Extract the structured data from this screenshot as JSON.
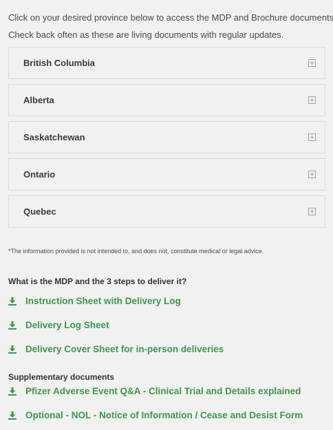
{
  "intro": {
    "line1": "Click on your desired province below to access the MDP and Brochure documents.",
    "line2": "Check back often as these are living documents with regular updates."
  },
  "provinces": [
    {
      "label": "British Columbia",
      "icon": "plus-square-icon"
    },
    {
      "label": "Alberta",
      "icon": "plus-square-icon"
    },
    {
      "label": "Saskatchewan",
      "icon": "plus-square-icon"
    },
    {
      "label": "Ontario",
      "icon": "plus-square-icon"
    },
    {
      "label": "Quebec",
      "icon": "plus-square-icon"
    }
  ],
  "disclaimer": "*The information provided is not intended to, and does not, constitute medical or legal advice.",
  "mdp_section": {
    "heading": "What is the MDP and the 3 steps to deliver it?",
    "links": [
      {
        "label": "Instruction Sheet with Delivery Log",
        "icon": "download-icon"
      },
      {
        "label": "Delivery Log Sheet",
        "icon": "download-icon"
      },
      {
        "label": "Delivery Cover Sheet for in-person deliveries",
        "icon": "download-icon"
      }
    ]
  },
  "supplementary_section": {
    "heading": "Supplementary documents",
    "links": [
      {
        "label": "Pfizer Adverse Event Q&A - Clinical Trial and Details explained",
        "icon": "download-icon"
      },
      {
        "label": "Optional - NOL - Notice of Information / Cease and Desist Form",
        "icon": "download-icon"
      }
    ]
  },
  "colors": {
    "background": "#f1f1f1",
    "link_green": "#3e9650",
    "border": "#d9d9d9"
  }
}
